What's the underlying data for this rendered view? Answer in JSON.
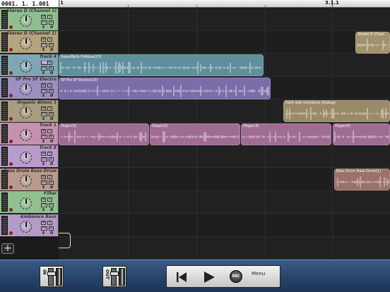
{
  "ruler": {
    "position": "0001. 1. 1.001",
    "marker_1": "1",
    "marker_3": "3.1.1"
  },
  "tracks": [
    {
      "name": "Stereo D (Channel 1)",
      "color": "#8fbf8f"
    },
    {
      "name": "Stereo D (Channel 1)",
      "color": "#b5a47c"
    },
    {
      "name": "Track 4",
      "color": "#7ea7b3",
      "pz": "PZ"
    },
    {
      "name": "SP Pro SF Electro",
      "color": "#9d8fc1"
    },
    {
      "name": "Organic Atmos 1",
      "color": "#a99c7f"
    },
    {
      "name": "Track 1",
      "color": "#c591b1"
    },
    {
      "name": "Track 8",
      "color": "#b99acb"
    },
    {
      "name": "Bass Drum Bass Drum",
      "color": "#b99a8c"
    },
    {
      "name": "Filter",
      "color": "#8fc08f"
    },
    {
      "name": "Ambience Bass",
      "color": "#b39ac9"
    }
  ],
  "track_buttons": {
    "mute": "M",
    "solo": "S",
    "fx": "FX",
    "rec": "R",
    "edit": "E",
    "phase": "Ø"
  },
  "clips": [
    {
      "lane": 1,
      "start": 420,
      "len": 49,
      "name": "Stereo D (Chan",
      "color": "#a2936c"
    },
    {
      "lane": 2,
      "start": 0,
      "len": 290,
      "name": "SuperBells Folkbox(10)",
      "color": "#5f8f9c"
    },
    {
      "lane": 3,
      "start": 0,
      "len": 300,
      "name": "SP Pro SF Electro(10)",
      "color": "#7b6da8"
    },
    {
      "lane": 4,
      "start": 318,
      "len": 151,
      "name": "Dark side miniature (Dialog)",
      "color": "#9b8a6a"
    },
    {
      "lane": 5,
      "start": 0,
      "len": 128,
      "name": "Organ(3)",
      "color": "#a06c93"
    },
    {
      "lane": 5,
      "start": 129,
      "len": 128,
      "name": "Organ(3)",
      "color": "#a06c93"
    },
    {
      "lane": 5,
      "start": 258,
      "len": 128,
      "name": "Organ(4)",
      "color": "#a06c93"
    },
    {
      "lane": 5,
      "start": 388,
      "len": 81,
      "name": "Organ(5)",
      "color": "#a06c93"
    },
    {
      "lane": 7,
      "start": 390,
      "len": 79,
      "name": "Bass Drum Bass Drum(1)",
      "color": "#9a7268"
    }
  ],
  "add_track_label": "+",
  "transport": {
    "in_label": "IN",
    "out_label": "OUT",
    "rec_label": "REC",
    "menu_label": "Menu",
    "rewind_icon": "rewind-icon",
    "play_icon": "play-icon"
  }
}
